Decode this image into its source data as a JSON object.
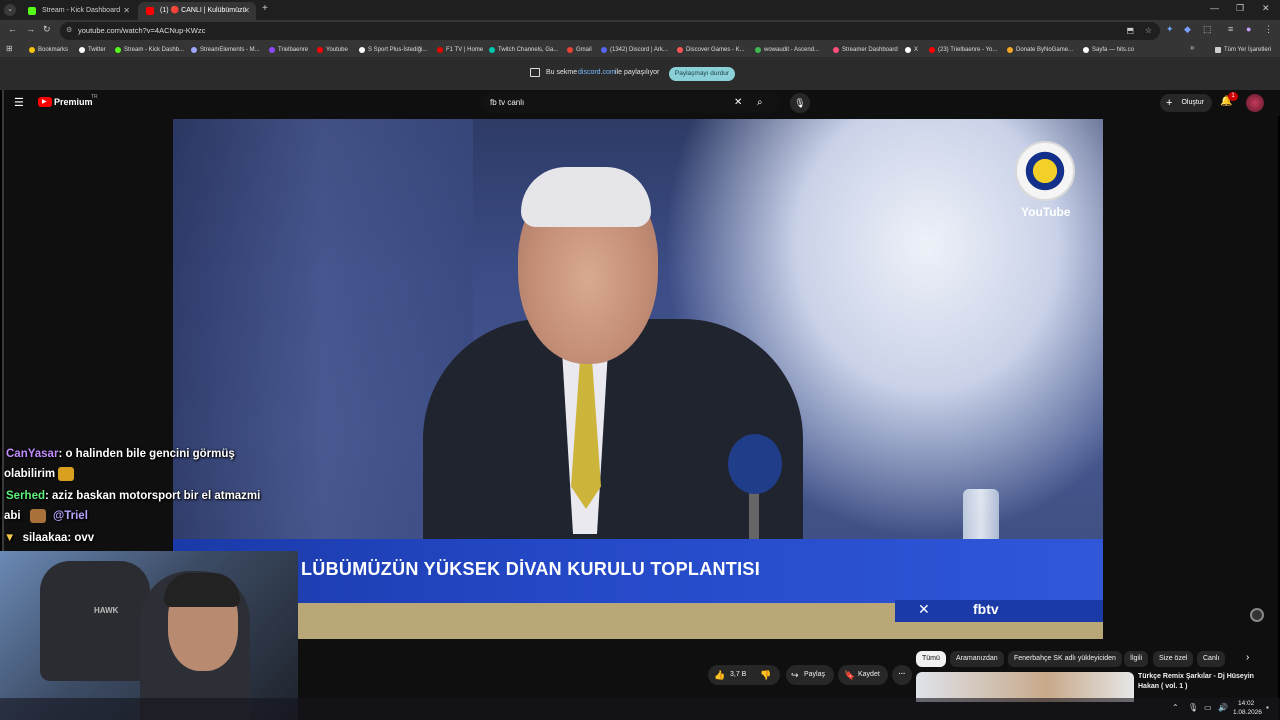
{
  "browser": {
    "tabs": [
      {
        "title": "Stream - Kick Dashboard",
        "favicon_color": "#53fc18"
      },
      {
        "title": "(1) 🔴 CANLI | Kulübümüzü",
        "favicon_color": "#ff0000"
      }
    ],
    "new_tab": "+",
    "url": "youtube.com/watch?v=4ACNup-KWzc",
    "bookmarks": [
      {
        "label": "Bookmarks",
        "color": "#f1c40f"
      },
      {
        "label": "Twitter",
        "color": "#ffffff"
      },
      {
        "label": "Stream - Kick Dashb...",
        "color": "#53fc18"
      },
      {
        "label": "StreamElements - M...",
        "color": "#9aa7ff"
      },
      {
        "label": "Trielbaenre",
        "color": "#9146ff"
      },
      {
        "label": "Youtube",
        "color": "#ff0000"
      },
      {
        "label": "S Sport Plus-İstediği...",
        "color": "#ffffff"
      },
      {
        "label": "F1 TV | Home",
        "color": "#e10600"
      },
      {
        "label": "Twitch Channels, Ga...",
        "color": "#00c8af"
      },
      {
        "label": "Gmail",
        "color": "#ea4335"
      },
      {
        "label": "(1342) Discord | Ark...",
        "color": "#5865f2"
      },
      {
        "label": "Discover Games - K...",
        "color": "#ff5555"
      },
      {
        "label": "wowaudit - Ascend...",
        "color": "#3fb950"
      },
      {
        "label": "Streamer Dashboard",
        "color": "#ff4f7b"
      },
      {
        "label": "X",
        "color": "#ffffff"
      },
      {
        "label": "(23) Trielbaenre - Yo...",
        "color": "#ff0000"
      },
      {
        "label": "Donate ByNoGame...",
        "color": "#f5a623"
      },
      {
        "label": "Sayfa — hits.co",
        "color": "#ffffff"
      }
    ],
    "all_bookmarks": "Tüm Yer İşaretleri",
    "share_bar": {
      "prefix": "Bu sekme",
      "site": "discord.com",
      "suffix": "ile paylaşılıyor",
      "stop_button": "Paylaşmayı durdur"
    }
  },
  "youtube": {
    "logo": "Premium",
    "logo_sup": "TR",
    "search_value": "fb tv canlı",
    "create_label": "Oluştur",
    "notification_count": "1",
    "video": {
      "banner_text": "LÜBÜMÜZÜN YÜKSEK DİVAN KURULU TOPLANTISI",
      "channel_tag": "fbtv",
      "watermark": "YouTube"
    },
    "actions": {
      "likes": "3,7 B",
      "share": "Paylaş",
      "save": "Kaydet",
      "more": "···"
    },
    "chips": [
      "Tümü",
      "Aramanızdan",
      "Fenerbahçe SK adlı yükleyiciden",
      "İlgili",
      "Size özel",
      "Canlı"
    ],
    "recommended_title": "Türkçe Remix Şarkılar - Dj Hüseyin Hakan ( vol. 1 )"
  },
  "chat": [
    {
      "user": "CanYasar",
      "user_color": "#c28cff",
      "message": ": o halinden bile gencini görmüş",
      "message_cont": "olabilirim"
    },
    {
      "user": "Serhed",
      "user_color": "#5cf07a",
      "message": ": aziz baskan motorsport bir el atmazmi",
      "message_cont": "abi",
      "mention": "@Triel"
    },
    {
      "user": "silaakaa",
      "user_color": "#ffffff",
      "message": ": ovv"
    }
  ],
  "webcam": {
    "brand": "HAWK"
  },
  "taskbar": {
    "time": "14:02",
    "date": "1.08.2026"
  }
}
